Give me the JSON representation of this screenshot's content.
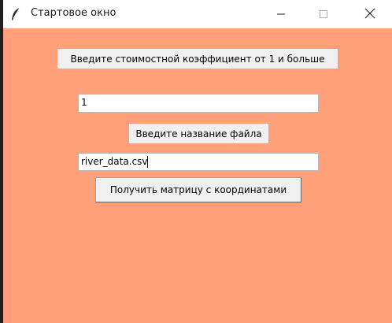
{
  "window": {
    "title": "Стартовое окно",
    "icon": "feather-icon",
    "background_color": "#ffa07a",
    "controls": {
      "minimize": "minimize-icon",
      "maximize": "maximize-icon",
      "close": "close-icon"
    }
  },
  "form": {
    "coefficient_label": "Введите стоимостной коэффициент от 1 и больше",
    "coefficient_value": "1",
    "filename_label": "Введите название файла",
    "filename_value": "river_data.csv",
    "submit_label": "Получить матрицу с координатами"
  }
}
